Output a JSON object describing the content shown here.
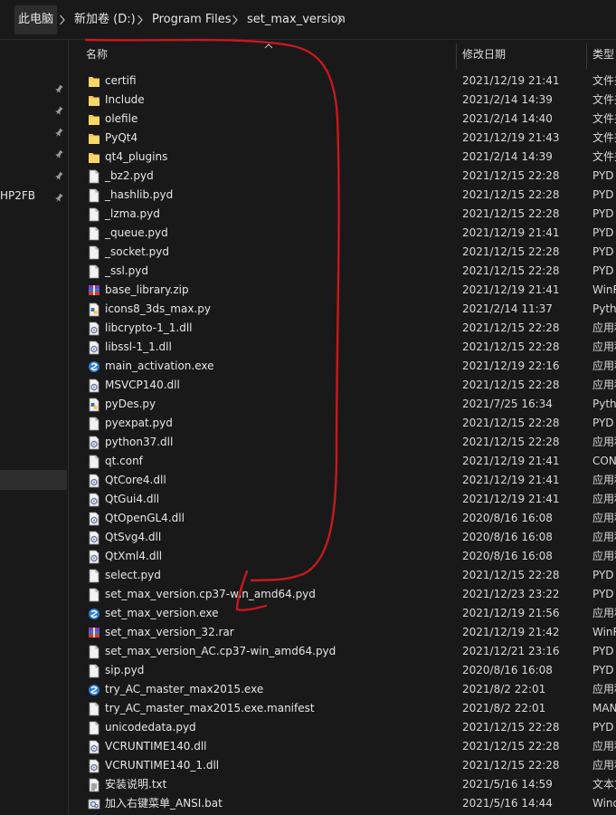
{
  "breadcrumb": [
    "此电脑",
    "新加卷 (D:)",
    "Program Files",
    "set_max_version"
  ],
  "nav": {
    "label": "HP2FB"
  },
  "columns": {
    "name": "名称",
    "date": "修改日期",
    "type": "类型"
  },
  "files": [
    {
      "name": "certifi",
      "date": "2021/12/19 21:41",
      "type": "文件夹",
      "icon": "folder-icon"
    },
    {
      "name": "Include",
      "date": "2021/2/14 14:39",
      "type": "文件夹",
      "icon": "folder-icon"
    },
    {
      "name": "olefile",
      "date": "2021/2/14 14:40",
      "type": "文件夹",
      "icon": "folder-icon"
    },
    {
      "name": "PyQt4",
      "date": "2021/12/19 21:43",
      "type": "文件夹",
      "icon": "folder-icon"
    },
    {
      "name": "qt4_plugins",
      "date": "2021/2/14 14:39",
      "type": "文件夹",
      "icon": "folder-icon"
    },
    {
      "name": "_bz2.pyd",
      "date": "2021/12/15 22:28",
      "type": "PYD",
      "icon": "file-icon"
    },
    {
      "name": "_hashlib.pyd",
      "date": "2021/12/15 22:28",
      "type": "PYD",
      "icon": "file-icon"
    },
    {
      "name": "_lzma.pyd",
      "date": "2021/12/15 22:28",
      "type": "PYD",
      "icon": "file-icon"
    },
    {
      "name": "_queue.pyd",
      "date": "2021/12/19 21:41",
      "type": "PYD",
      "icon": "file-icon"
    },
    {
      "name": "_socket.pyd",
      "date": "2021/12/15 22:28",
      "type": "PYD",
      "icon": "file-icon"
    },
    {
      "name": "_ssl.pyd",
      "date": "2021/12/15 22:28",
      "type": "PYD",
      "icon": "file-icon"
    },
    {
      "name": "base_library.zip",
      "date": "2021/12/19 21:41",
      "type": "WinRAR",
      "icon": "archive-icon"
    },
    {
      "name": "icons8_3ds_max.py",
      "date": "2021/2/14 11:37",
      "type": "Python",
      "icon": "python-icon"
    },
    {
      "name": "libcrypto-1_1.dll",
      "date": "2021/12/15 22:28",
      "type": "应用程序扩展",
      "icon": "dll-icon"
    },
    {
      "name": "libssl-1_1.dll",
      "date": "2021/12/15 22:28",
      "type": "应用程序扩展",
      "icon": "dll-icon"
    },
    {
      "name": "main_activation.exe",
      "date": "2021/12/19 22:16",
      "type": "应用程序",
      "icon": "exe-icon"
    },
    {
      "name": "MSVCP140.dll",
      "date": "2021/12/15 22:28",
      "type": "应用程序扩展",
      "icon": "dll-icon"
    },
    {
      "name": "pyDes.py",
      "date": "2021/7/25 16:34",
      "type": "Python",
      "icon": "python-icon"
    },
    {
      "name": "pyexpat.pyd",
      "date": "2021/12/15 22:28",
      "type": "PYD",
      "icon": "file-icon"
    },
    {
      "name": "python37.dll",
      "date": "2021/12/15 22:28",
      "type": "应用程序扩展",
      "icon": "dll-icon"
    },
    {
      "name": "qt.conf",
      "date": "2021/12/19 21:41",
      "type": "CONF",
      "icon": "file-icon"
    },
    {
      "name": "QtCore4.dll",
      "date": "2021/12/19 21:41",
      "type": "应用程序扩展",
      "icon": "dll-icon"
    },
    {
      "name": "QtGui4.dll",
      "date": "2021/12/19 21:41",
      "type": "应用程序扩展",
      "icon": "dll-icon"
    },
    {
      "name": "QtOpenGL4.dll",
      "date": "2020/8/16 16:08",
      "type": "应用程序扩展",
      "icon": "dll-icon"
    },
    {
      "name": "QtSvg4.dll",
      "date": "2020/8/16 16:08",
      "type": "应用程序扩展",
      "icon": "dll-icon"
    },
    {
      "name": "QtXml4.dll",
      "date": "2020/8/16 16:08",
      "type": "应用程序扩展",
      "icon": "dll-icon"
    },
    {
      "name": "select.pyd",
      "date": "2021/12/15 22:28",
      "type": "PYD",
      "icon": "file-icon"
    },
    {
      "name": "set_max_version.cp37-win_amd64.pyd",
      "date": "2021/12/23 23:22",
      "type": "PYD",
      "icon": "file-icon"
    },
    {
      "name": "set_max_version.exe",
      "date": "2021/12/19 21:56",
      "type": "应用程序",
      "icon": "exe-icon"
    },
    {
      "name": "set_max_version_32.rar",
      "date": "2021/12/19 21:42",
      "type": "WinRAR",
      "icon": "archive-icon"
    },
    {
      "name": "set_max_version_AC.cp37-win_amd64.pyd",
      "date": "2021/12/21 23:16",
      "type": "PYD",
      "icon": "file-icon"
    },
    {
      "name": "sip.pyd",
      "date": "2020/8/16 16:08",
      "type": "PYD",
      "icon": "file-icon"
    },
    {
      "name": "try_AC_master_max2015.exe",
      "date": "2021/8/2 22:01",
      "type": "应用程序",
      "icon": "exe-icon"
    },
    {
      "name": "try_AC_master_max2015.exe.manifest",
      "date": "2021/8/2 22:01",
      "type": "MANIFEST",
      "icon": "file-icon"
    },
    {
      "name": "unicodedata.pyd",
      "date": "2021/12/15 22:28",
      "type": "PYD",
      "icon": "file-icon"
    },
    {
      "name": "VCRUNTIME140.dll",
      "date": "2021/12/15 22:28",
      "type": "应用程序扩展",
      "icon": "dll-icon"
    },
    {
      "name": "VCRUNTIME140_1.dll",
      "date": "2021/12/15 22:28",
      "type": "应用程序扩展",
      "icon": "dll-icon"
    },
    {
      "name": "安装说明.txt",
      "date": "2021/5/16 14:59",
      "type": "文本文档",
      "icon": "text-icon"
    },
    {
      "name": "加入右键菜单_ANSI.bat",
      "date": "2021/5/16 14:44",
      "type": "Windows",
      "icon": "bat-icon"
    }
  ],
  "colors": {
    "background": "#191919",
    "text": "#e6e6e6",
    "annotation": "#c8181e",
    "folder": "#f4c64d",
    "selection": "#2d2d2d"
  }
}
